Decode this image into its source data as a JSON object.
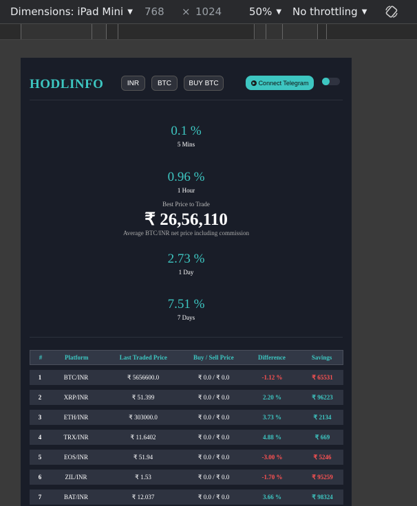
{
  "devtools": {
    "dimensions_label": "Dimensions: iPad Mini",
    "width": "768",
    "times": "×",
    "height": "1024",
    "zoom": "50%",
    "throttling": "No throttling",
    "icons": {
      "caret": "caret-down-icon",
      "rotate": "rotate-icon"
    }
  },
  "header": {
    "logo": "HODLINFO",
    "currency": "INR",
    "coin": "BTC",
    "buy": "BUY BTC",
    "telegram": "Connect Telegram"
  },
  "stats": [
    {
      "pct": "0.1 %",
      "label": "5 Mins"
    },
    {
      "pct": "0.96 %",
      "label": "1 Hour"
    },
    {
      "pct": "2.73 %",
      "label": "1 Day"
    },
    {
      "pct": "7.51 %",
      "label": "7 Days"
    }
  ],
  "best": {
    "title": "Best Price to Trade",
    "price": "₹ 26,56,110",
    "subtitle": "Average BTC/INR net price including commission"
  },
  "table": {
    "headers": [
      "#",
      "Platform",
      "Last Traded Price",
      "Buy / Sell Price",
      "Difference",
      "Savings"
    ],
    "rows": [
      {
        "n": "1",
        "platform": "BTC/INR",
        "last": "₹ 5656600.0",
        "buysell": "₹ 0.0 / ₹ 0.0",
        "diff": "-1.12 %",
        "savings": "₹ 65531",
        "neg": true
      },
      {
        "n": "2",
        "platform": "XRP/INR",
        "last": "₹ 51.399",
        "buysell": "₹ 0.0 / ₹ 0.0",
        "diff": "2.20 %",
        "savings": "₹ 96223",
        "neg": false
      },
      {
        "n": "3",
        "platform": "ETH/INR",
        "last": "₹ 303000.0",
        "buysell": "₹ 0.0 / ₹ 0.0",
        "diff": "3.73 %",
        "savings": "₹ 2134",
        "neg": false
      },
      {
        "n": "4",
        "platform": "TRX/INR",
        "last": "₹ 11.6402",
        "buysell": "₹ 0.0 / ₹ 0.0",
        "diff": "4.88 %",
        "savings": "₹ 669",
        "neg": false
      },
      {
        "n": "5",
        "platform": "EOS/INR",
        "last": "₹ 51.94",
        "buysell": "₹ 0.0 / ₹ 0.0",
        "diff": "-3.00 %",
        "savings": "₹ 5246",
        "neg": true
      },
      {
        "n": "6",
        "platform": "ZIL/INR",
        "last": "₹ 1.53",
        "buysell": "₹ 0.0 / ₹ 0.0",
        "diff": "-1.70 %",
        "savings": "₹ 95259",
        "neg": true
      },
      {
        "n": "7",
        "platform": "BAT/INR",
        "last": "₹ 12.037",
        "buysell": "₹ 0.0 / ₹ 0.0",
        "diff": "3.66 %",
        "savings": "₹ 98324",
        "neg": false
      }
    ]
  },
  "colors": {
    "accent": "#3dc6c1",
    "negative": "#ff5252",
    "page_bg": "#191d28"
  }
}
